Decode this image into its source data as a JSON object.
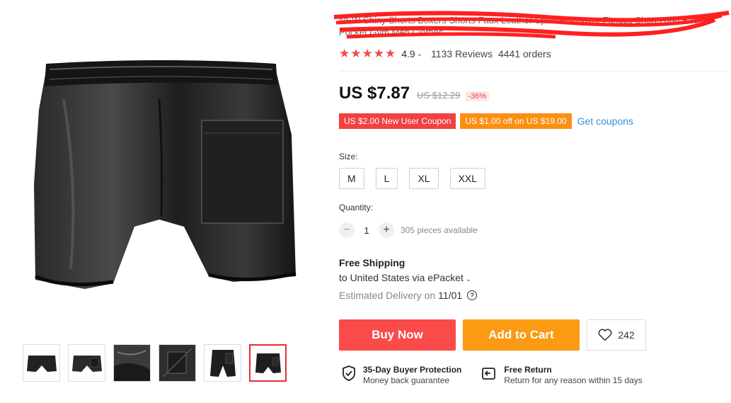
{
  "product": {
    "title": "NEW Shiny Shorts Boxers Shorts Faux Leather Sport Hot Boxer Fitness Shorts and Back Pocket Gym Men Clothes",
    "rating": "4.9",
    "reviews": "1133 Reviews",
    "orders": "4441 orders",
    "price": "US $7.87",
    "old_price": "US $12.29",
    "discount": "-36%"
  },
  "coupons": {
    "new_user": "US $2.00 New User Coupon",
    "off": "US $1.00 off on US $19.00",
    "get": "Get coupons"
  },
  "size": {
    "label": "Size:",
    "options": [
      "M",
      "L",
      "XL",
      "XXL"
    ]
  },
  "quantity": {
    "label": "Quantity:",
    "minus": "−",
    "value": "1",
    "plus": "+",
    "available": "305 pieces available"
  },
  "shipping": {
    "title": "Free Shipping",
    "destination": "to United States via ePacket",
    "delivery_label": "Estimated Delivery on",
    "delivery_date": "11/01",
    "help": "?"
  },
  "actions": {
    "buy_now": "Buy Now",
    "add_to_cart": "Add to Cart",
    "wishlist_count": "242"
  },
  "guarantees": {
    "protection_title": "35-Day Buyer Protection",
    "protection_sub": "Money back guarantee",
    "return_title": "Free Return",
    "return_sub": "Return for any reason within 15 days"
  },
  "colors": {
    "accent_red": "#fa4a4a",
    "accent_orange": "#fb9a13",
    "star": "#f04a4a",
    "link": "#3a8fd9"
  }
}
